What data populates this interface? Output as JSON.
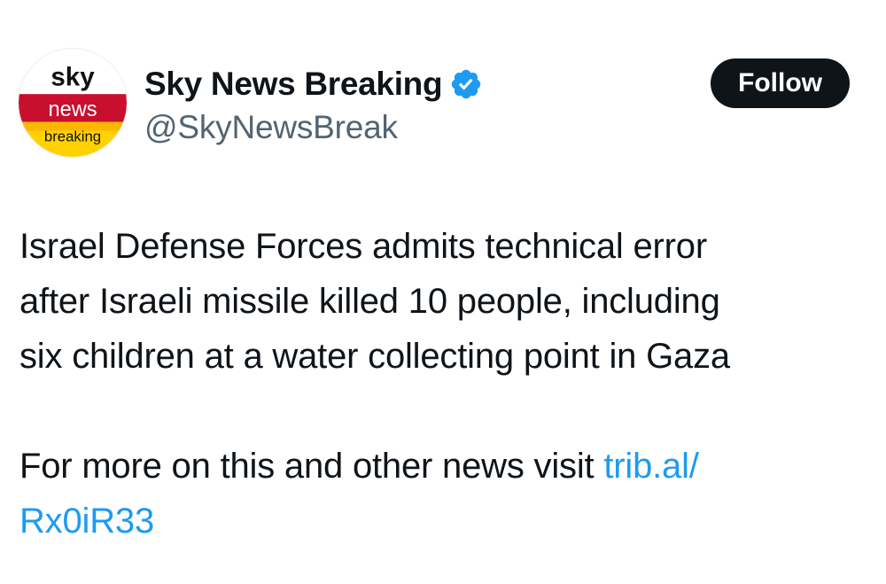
{
  "author": {
    "avatar": {
      "icon": "sky-news-breaking-logo",
      "logo_text_top": "sky",
      "logo_text_middle": "news",
      "logo_text_bottom": "breaking",
      "colors": {
        "top": "#ffffff",
        "middle": "#c8102e",
        "bottom": "#ffd100"
      }
    },
    "display_name": "Sky News Breaking",
    "verified_icon": "verified-badge-icon",
    "handle": "@SkyNewsBreak"
  },
  "follow_button": {
    "label": "Follow"
  },
  "tweet": {
    "line1": "Israel Defense Forces admits technical error",
    "line2": "after Israeli missile killed 10 people, including",
    "line3": "six children at a water collecting point in Gaza",
    "line4_text": "For more on this and other news visit ",
    "link_part1": "trib.al/",
    "link_part2": "Rx0iR33"
  },
  "colors": {
    "text": "#0f1419",
    "secondary_text": "#536471",
    "link": "#1d9bf0",
    "verified": "#1d9bf0",
    "button_bg": "#0f1419",
    "button_text": "#ffffff"
  }
}
